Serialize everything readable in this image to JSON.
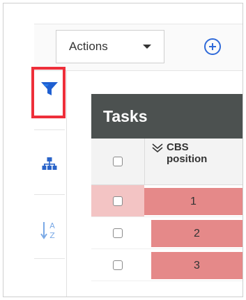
{
  "toolbar": {
    "actions_label": "Actions",
    "add_icon": "plus-circle-icon"
  },
  "rail": {
    "filter_icon": "filter-icon",
    "hierarchy_icon": "hierarchy-icon",
    "sort_icon": "sort-az-icon"
  },
  "grid": {
    "title": "Tasks",
    "column_cbs_line1": "CBS",
    "column_cbs_line2": "position",
    "rows": [
      {
        "cbs": "1",
        "selected": true
      },
      {
        "cbs": "2",
        "selected": false
      },
      {
        "cbs": "3",
        "selected": false
      }
    ]
  },
  "colors": {
    "accent": "#2f6ad9",
    "highlight": "#ee2f3a",
    "header_bg": "#4c5150",
    "row_fill": "#e58989",
    "selected_check_bg": "#f3c4c4"
  }
}
